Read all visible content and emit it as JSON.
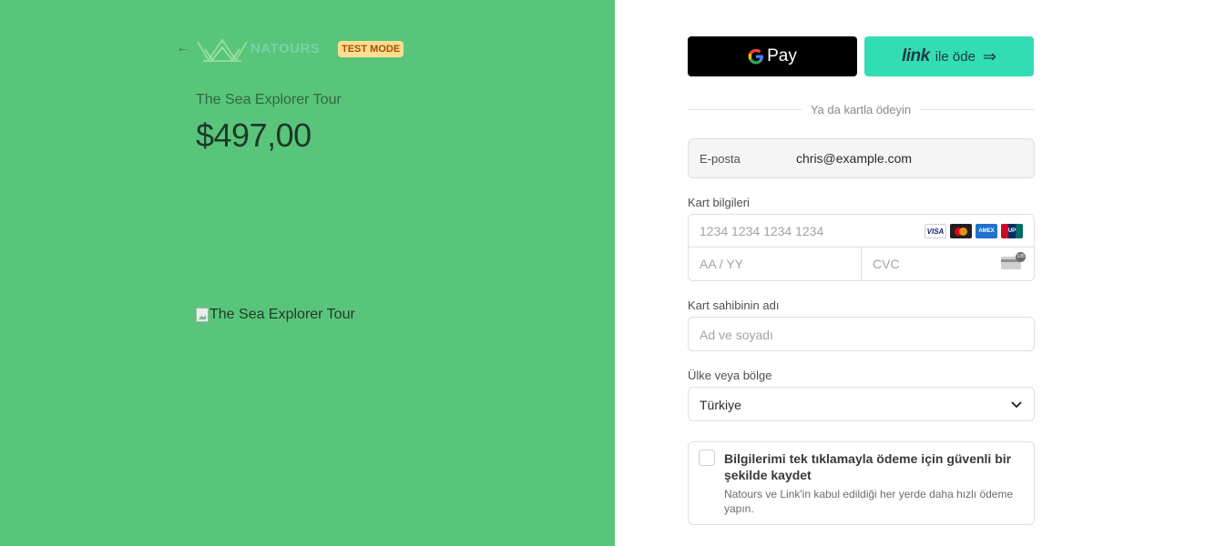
{
  "left": {
    "back_icon": "arrow-left-icon",
    "brand": "NATOURS",
    "badge": "TEST MODE",
    "product_name": "The Sea Explorer Tour",
    "price": "$497,00",
    "image_alt": "The Sea Explorer Tour"
  },
  "payment": {
    "gpay_label": "Pay",
    "link_logo": "link",
    "link_text": "ile öde",
    "divider_text": "Ya da kartla ödeyin"
  },
  "form": {
    "email_label": "E-posta",
    "email_value": "chris@example.com",
    "card_label": "Kart bilgileri",
    "card_number_placeholder": "1234 1234 1234 1234",
    "card_brands": [
      "VISA",
      "MC",
      "AMEX",
      "UP"
    ],
    "expiry_placeholder": "AA / YY",
    "cvc_placeholder": "CVC",
    "cvc_badge": "135",
    "name_label": "Kart sahibinin adı",
    "name_placeholder": "Ad ve soyadı",
    "country_label": "Ülke veya bölge",
    "country_value": "Türkiye",
    "save_title": "Bilgilerimi tek tıklamayla ödeme için güvenli bir şekilde kaydet",
    "save_desc": "Natours ve Link'in kabul edildiği her yerde daha hızlı ödeme yapın."
  },
  "colors": {
    "left_bg": "#59c57a",
    "link_btn": "#33ddb3",
    "gpay_btn": "#000000",
    "badge_bg": "#ffde92"
  }
}
